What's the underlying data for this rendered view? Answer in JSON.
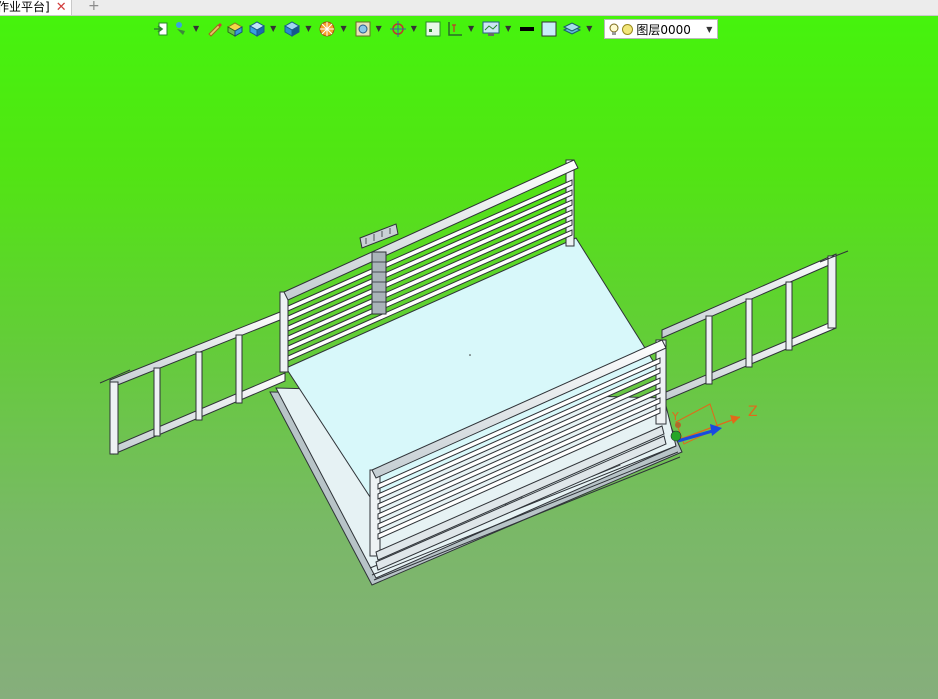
{
  "tabs": {
    "doc_label": "作业平台]",
    "close_glyph": "✕",
    "new_tab_glyph": "+"
  },
  "toolbar": {
    "icons": [
      "exit-icon",
      "pointer-icon",
      "pencil-icon",
      "box-icon",
      "cube-icon",
      "solid-icon",
      "render-icon",
      "view-icon",
      "snap-icon",
      "frame-icon",
      "dimension-icon",
      "display-icon",
      "line-color-icon",
      "fill-color-icon",
      "layer-icon"
    ],
    "layer_name": "图层0000",
    "dropdown_glyph": "▼"
  },
  "axes": {
    "z_label": "Z",
    "y_label": "Y"
  },
  "colors": {
    "background_top": "#44f50c",
    "background_bottom": "#86ae7c",
    "floor": "#d8f8fa",
    "frame": "#eef2f4",
    "outline": "#3a3f44",
    "axis_orange": "#e06a1a",
    "axis_blue": "#1a4ae0"
  }
}
